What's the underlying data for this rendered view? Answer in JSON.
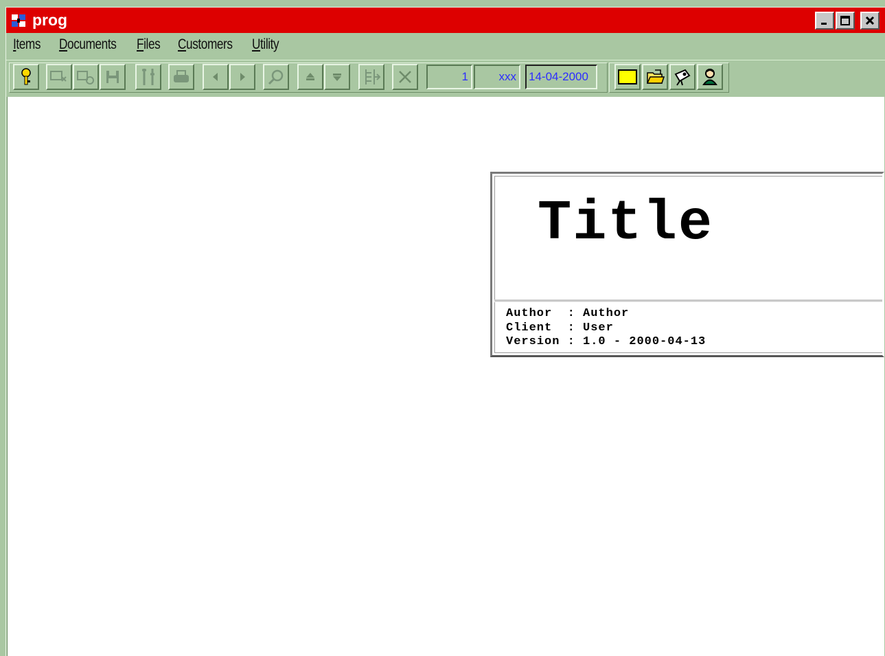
{
  "window": {
    "title": "prog"
  },
  "menu": {
    "items": [
      {
        "accel": "I",
        "rest": "tems"
      },
      {
        "accel": "D",
        "rest": "ocuments"
      },
      {
        "accel": "F",
        "rest": "iles"
      },
      {
        "accel": "C",
        "rest": "ustomers"
      },
      {
        "accel": "U",
        "rest": "tility"
      }
    ]
  },
  "toolbar": {
    "record_number": "1",
    "code_value": "xxx",
    "date_value": "14-04-2000"
  },
  "titlebox": {
    "title": "Title",
    "lines": [
      {
        "key": "Author ",
        "value": "Author"
      },
      {
        "key": "Client ",
        "value": "User"
      },
      {
        "key": "Version",
        "value": "1.0 - 2000-04-13"
      }
    ]
  },
  "colors": {
    "titlebar": "#dd0000",
    "chrome": "#a9c7a2",
    "field_text": "#2c2cff",
    "note_yellow": "#ffff00"
  }
}
